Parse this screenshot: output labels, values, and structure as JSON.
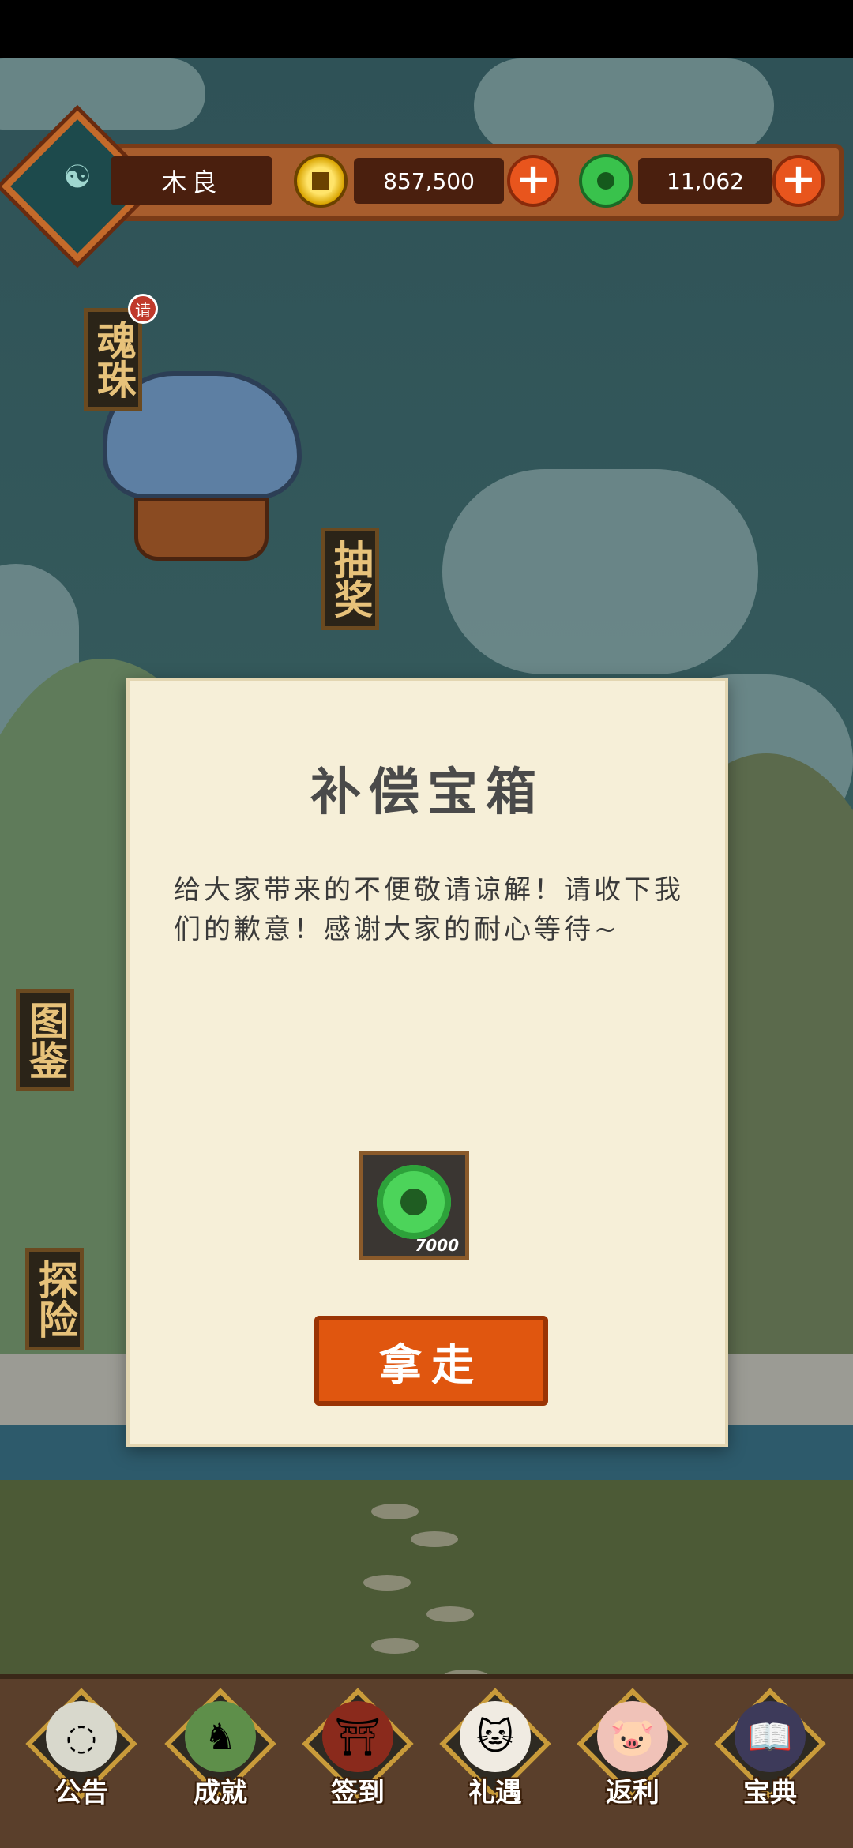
{
  "header": {
    "player_name": "木良",
    "gold_amount": "857,500",
    "jade_amount": "11,062",
    "gold_icon": "gold-coin-icon",
    "jade_icon": "jade-ring-icon",
    "plus_label": "+"
  },
  "side_banners": {
    "soul_bead": "魂珠",
    "soul_bead_tag": "请",
    "lottery": "抽奖",
    "atlas": "图鉴",
    "explore": "探险"
  },
  "dialog": {
    "title": "补偿宝箱",
    "message": "给大家带来的不便敬请谅解！请收下我们的歉意！感谢大家的耐心等待~",
    "reward_icon": "jade-ring-icon",
    "reward_quantity": "7000",
    "take_button": "拿走"
  },
  "bottom_nav": {
    "items": [
      {
        "label": "公告",
        "icon": "bowl-icon"
      },
      {
        "label": "成就",
        "icon": "dragon-icon"
      },
      {
        "label": "签到",
        "icon": "gate-icon"
      },
      {
        "label": "礼遇",
        "icon": "lucky-cat-icon"
      },
      {
        "label": "返利",
        "icon": "pig-icon"
      },
      {
        "label": "宝典",
        "icon": "book-icon"
      }
    ]
  },
  "colors": {
    "panel_bg": "#f6efd8",
    "button_orange": "#e0560f",
    "header_brown": "#a85d2d",
    "nav_gold": "#c99b3a"
  }
}
